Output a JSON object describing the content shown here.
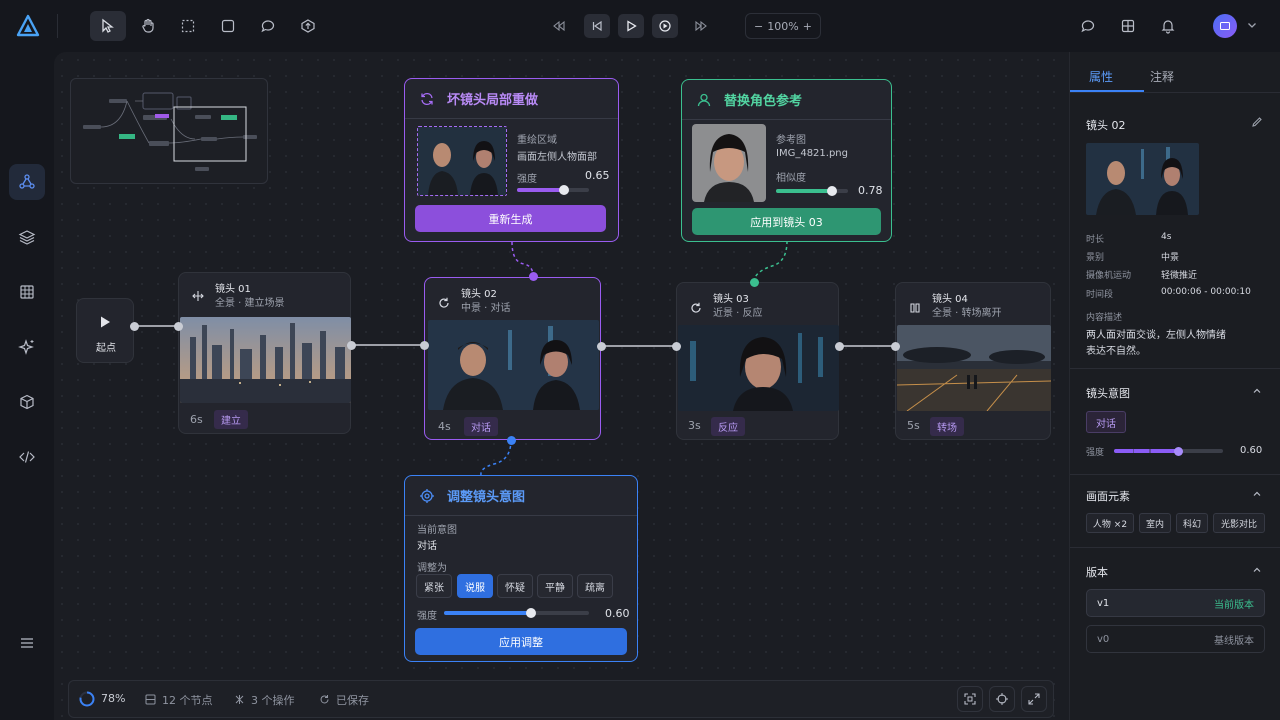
{
  "toolbar": {
    "zoom": "100%"
  },
  "minimap": {},
  "start": {
    "label": "起点"
  },
  "shots": [
    {
      "title": "镜头 01",
      "sub": "全景 · 建立场景",
      "dur": "6s",
      "tag": "建立"
    },
    {
      "title": "镜头 02",
      "sub": "中景 · 对话",
      "dur": "4s",
      "tag": "对话"
    },
    {
      "title": "镜头 03",
      "sub": "近景 · 反应",
      "dur": "3s",
      "tag": "反应"
    },
    {
      "title": "镜头 04",
      "sub": "全景 · 转场离开",
      "dur": "5s",
      "tag": "转场"
    }
  ],
  "redo": {
    "title": "坏镜头局部重做",
    "area_label": "重绘区域",
    "area_value": "画面左侧人物面部",
    "strength_label": "强度",
    "strength_value": "0.65",
    "strength": 0.65,
    "button": "重新生成",
    "accent": "#9a5cf0"
  },
  "replace": {
    "title": "替换角色参考",
    "ref_label": "参考图",
    "ref_value": "IMG_4821.png",
    "sim_label": "相似度",
    "sim_value": "0.78",
    "sim": 0.78,
    "button": "应用到镜头 03",
    "accent": "#3bbf8f"
  },
  "intent": {
    "title": "调整镜头意图",
    "current_label": "当前意图",
    "current_value": "对话",
    "adjust_label": "调整为",
    "options": [
      "紧张",
      "说服",
      "怀疑",
      "平静",
      "疏离"
    ],
    "selected": "说服",
    "strength_label": "强度",
    "strength_value": "0.60",
    "strength": 0.6,
    "button": "应用调整",
    "accent": "#3b82f6"
  },
  "status": {
    "progress": "78%",
    "progress_value": 0.78,
    "nodes": "12 个节点",
    "ops": "3 个操作",
    "saved": "已保存"
  },
  "right": {
    "tabs": [
      "属性",
      "注释"
    ],
    "shot_title": "镜头 02",
    "props": [
      [
        "时长",
        "4s"
      ],
      [
        "景别",
        "中景"
      ],
      [
        "摄像机运动",
        "轻微推近"
      ],
      [
        "时间段",
        "00:00:06 - 00:00:10"
      ]
    ],
    "desc_label": "内容描述",
    "desc_text1": "两人面对面交谈，左侧人物情绪",
    "desc_text2": "表达不自然。",
    "intent_title": "镜头意图",
    "intent_tag": "对话",
    "intent_strength_label": "强度",
    "intent_strength_value": "0.60",
    "intent_strength": 0.6,
    "elements_title": "画面元素",
    "elements": [
      "人物 ×2",
      "室内",
      "科幻",
      "光影对比"
    ],
    "version_title": "版本",
    "versions": [
      {
        "name": "v1",
        "status": "当前版本"
      },
      {
        "name": "v0",
        "status": "基线版本"
      }
    ]
  }
}
